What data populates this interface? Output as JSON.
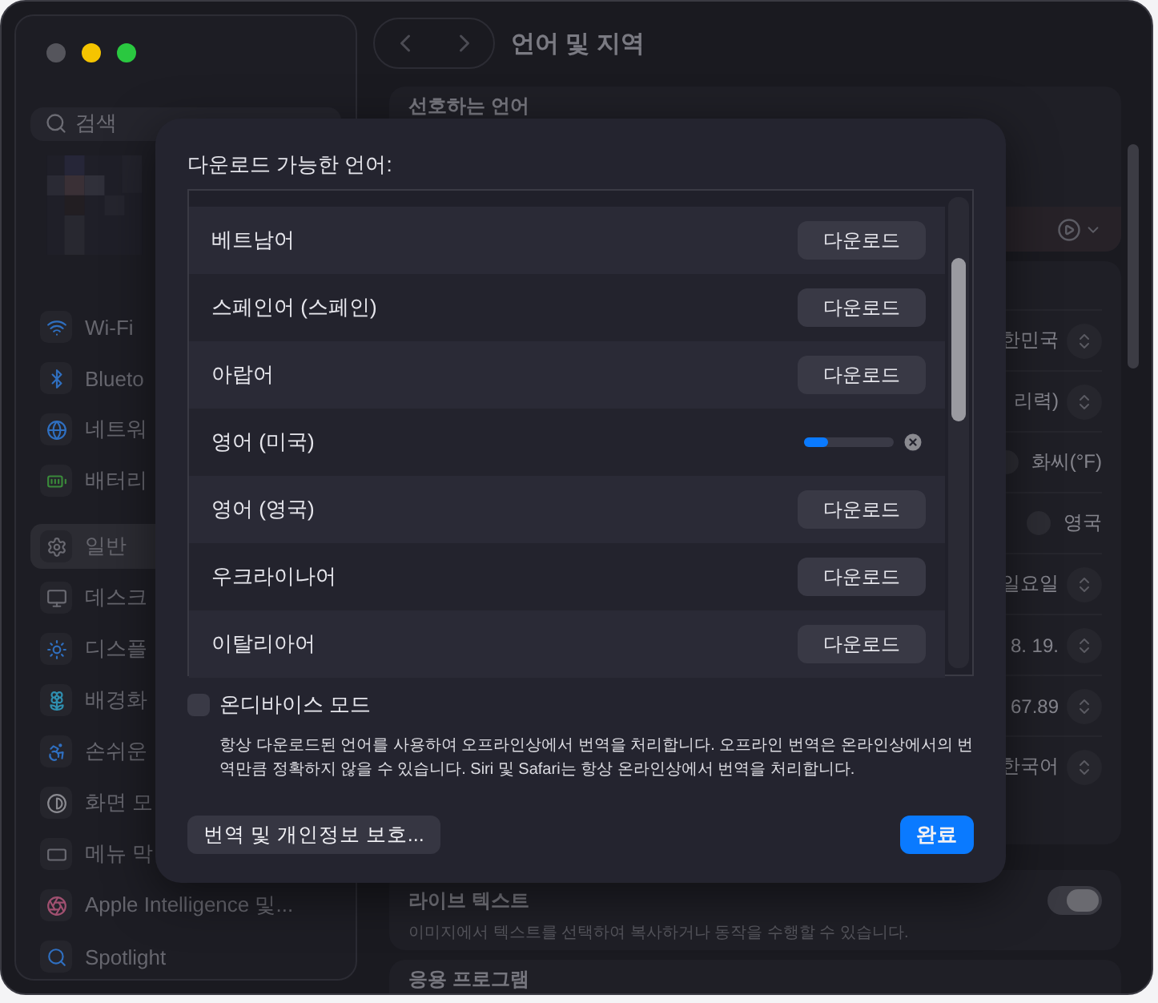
{
  "window": {
    "title": "언어 및 지역"
  },
  "sidebar": {
    "search": {
      "placeholder": "검색"
    },
    "groups": [
      {
        "items": [
          {
            "label": "Wi-Fi",
            "selected": false
          },
          {
            "label": "Blueto",
            "selected": false
          },
          {
            "label": "네트워",
            "selected": false
          },
          {
            "label": "배터리",
            "selected": false
          }
        ]
      },
      {
        "items": [
          {
            "label": "일반",
            "selected": true
          },
          {
            "label": "데스크",
            "selected": false
          },
          {
            "label": "디스플",
            "selected": false
          },
          {
            "label": "배경화",
            "selected": false
          },
          {
            "label": "손쉬운",
            "selected": false
          },
          {
            "label": "화면 모",
            "selected": false
          },
          {
            "label": "메뉴 막",
            "selected": false
          },
          {
            "label": "Apple Intelligence 및...",
            "selected": false
          },
          {
            "label": "Spotlight",
            "selected": false
          }
        ]
      }
    ]
  },
  "preferred_languages": {
    "heading": "선호하는 언어"
  },
  "region_settings": [
    {
      "kind": "select",
      "value": "한민국"
    },
    {
      "kind": "select",
      "value": "리력)"
    },
    {
      "kind": "radio",
      "value": "화씨(°F)",
      "selected": false
    },
    {
      "kind": "radio",
      "value": "영국",
      "selected": false
    },
    {
      "kind": "select",
      "value": "일요일"
    },
    {
      "kind": "select",
      "value": "8. 19."
    },
    {
      "kind": "select",
      "value": "67.89"
    },
    {
      "kind": "select",
      "value": "한국어"
    }
  ],
  "live_text": {
    "title": "라이브 텍스트",
    "description": "이미지에서 텍스트를 선택하여 복사하거나 동작을 수행할 수 있습니다.",
    "on": true
  },
  "applications": {
    "heading": "응용 프로그램"
  },
  "dialog": {
    "title": "다운로드 가능한 언어:",
    "languages": [
      {
        "name": "베트남어",
        "kind": "download",
        "button": "다운로드"
      },
      {
        "name": "스페인어 (스페인)",
        "kind": "download",
        "button": "다운로드"
      },
      {
        "name": "아랍어",
        "kind": "download",
        "button": "다운로드"
      },
      {
        "name": "영어 (미국)",
        "kind": "downloading",
        "level": 0.27
      },
      {
        "name": "영어 (영국)",
        "kind": "download",
        "button": "다운로드"
      },
      {
        "name": "우크라이나어",
        "kind": "download",
        "button": "다운로드"
      },
      {
        "name": "이탈리아어",
        "kind": "download",
        "button": "다운로드"
      }
    ],
    "on_device_mode": {
      "label": "온디바이스 모드",
      "checked": false,
      "description": "항상 다운로드된 언어를 사용하여 오프라인상에서 번역을 처리합니다. 오프라인 번역은 온라인상에서의 번역만큼 정확하지 않을 수 있습니다. Siri 및 Safari는 항상 온라인상에서 번역을 처리합니다."
    },
    "buttons": [
      {
        "label": "번역 및 개인정보 보호...",
        "kind": "secondary"
      },
      {
        "label": "완료",
        "kind": "primary"
      }
    ]
  }
}
